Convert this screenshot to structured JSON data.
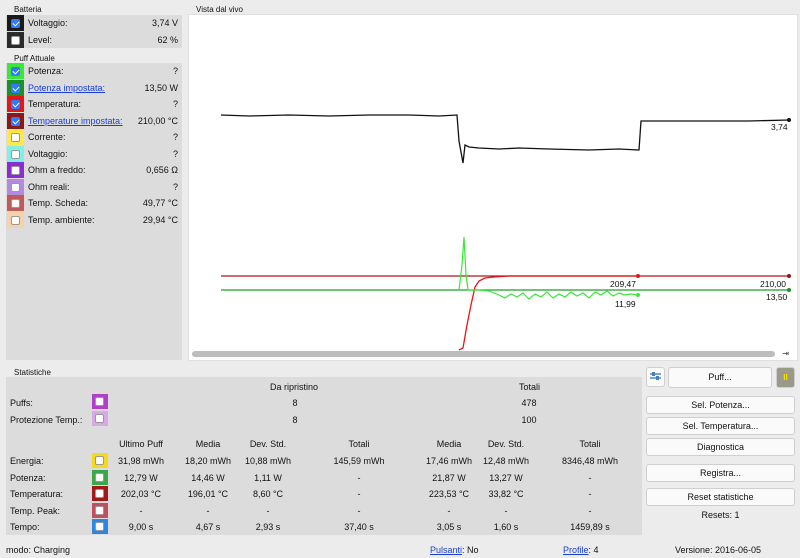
{
  "battery": {
    "title": "Batteria",
    "rows": [
      {
        "label": "Voltaggio:",
        "value": "3,74 V",
        "color": "#1a1a1a",
        "checked": true
      },
      {
        "label": "Level:",
        "value": "62 %",
        "color": "#2b2b2b",
        "checked": false
      }
    ]
  },
  "puff": {
    "title": "Puff Attuale",
    "rows": [
      {
        "label": "Potenza:",
        "value": "?",
        "color": "#3be63b",
        "checked": true,
        "link": false
      },
      {
        "label": "Potenza impostata:",
        "value": "13,50 W",
        "color": "#1f8f2a",
        "checked": true,
        "link": true
      },
      {
        "label": "Temperatura:",
        "value": "?",
        "color": "#e01818",
        "checked": true,
        "link": false
      },
      {
        "label": "Temperature impostata:",
        "value": "210,00 °C",
        "color": "#8a1a1a",
        "checked": true,
        "link": true
      },
      {
        "label": "Corrente:",
        "value": "?",
        "color": "#ffe84a",
        "checked": false,
        "link": false
      },
      {
        "label": "Voltaggio:",
        "value": "?",
        "color": "#7ff0e6",
        "checked": false,
        "link": false
      },
      {
        "label": "Ohm a freddo:",
        "value": "0,656 Ω",
        "color": "#8a2ecf",
        "checked": false,
        "link": false
      },
      {
        "label": "Ohm reali:",
        "value": "?",
        "color": "#b48ade",
        "checked": false,
        "link": false
      },
      {
        "label": "Temp. Scheda:",
        "value": "49,77 °C",
        "color": "#c05a5a",
        "checked": false,
        "link": false
      },
      {
        "label": "Temp. ambiente:",
        "value": "29,94 °C",
        "color": "#f5d2a8",
        "checked": false,
        "link": false
      }
    ]
  },
  "live": {
    "title": "Vista dal vivo",
    "voltage_label": "3,74",
    "temp_now_label": "209,47",
    "temp_set_label": "210,00",
    "power_set_label": "13,50",
    "power_now_label": "11,99"
  },
  "stats": {
    "title": "Statistiche",
    "header_reset": "Da ripristino",
    "header_total": "Totali",
    "puffs_label": "Puffs:",
    "puffs_color": "#b040c8",
    "puffs_reset": "8",
    "puffs_total": "478",
    "prot_label": "Protezione Temp.:",
    "prot_color": "#d9a8e6",
    "prot_reset": "8",
    "prot_total": "100",
    "cols": [
      "Ultimo Puff",
      "Media",
      "Dev. Std.",
      "Totali",
      "Media",
      "Dev. Std.",
      "Totali"
    ],
    "rows": [
      {
        "label": "Energia:",
        "color": "#f5d820",
        "values": [
          "31,98 mWh",
          "18,20 mWh",
          "10,88 mWh",
          "145,59 mWh",
          "17,46 mWh",
          "12,48 mWh",
          "8346,48 mWh"
        ]
      },
      {
        "label": "Potenza:",
        "color": "#3aa84a",
        "values": [
          "12,79 W",
          "14,46 W",
          "1,11 W",
          "-",
          "21,87 W",
          "13,27 W",
          "-"
        ]
      },
      {
        "label": "Temperatura:",
        "color": "#a01a1a",
        "values": [
          "202,03 °C",
          "196,01 °C",
          "8,60 °C",
          "-",
          "223,53 °C",
          "33,82 °C",
          "-"
        ]
      },
      {
        "label": "Temp. Peak:",
        "color": "#c05060",
        "values": [
          "-",
          "-",
          "-",
          "-",
          "-",
          "-",
          "-"
        ]
      },
      {
        "label": "Tempo:",
        "color": "#2f86e0",
        "values": [
          "9,00 s",
          "4,67 s",
          "2,93 s",
          "37,40 s",
          "3,05 s",
          "1,60 s",
          "1459,89 s"
        ]
      }
    ]
  },
  "buttons": {
    "puff": "Puff...",
    "pause": "II",
    "sel_power": "Sel. Potenza...",
    "sel_temp": "Sel. Temperatura...",
    "diagnostics": "Diagnostica",
    "register": "Registra...",
    "reset_stats": "Reset statistiche",
    "resets": "Resets: 1"
  },
  "status": {
    "mode": "modo: Charging",
    "buttons_label": "Pulsanti",
    "buttons_value": ": No",
    "profile_label": "Profile",
    "profile_value": ": 4",
    "version": "Versione: 2016-06-05"
  }
}
